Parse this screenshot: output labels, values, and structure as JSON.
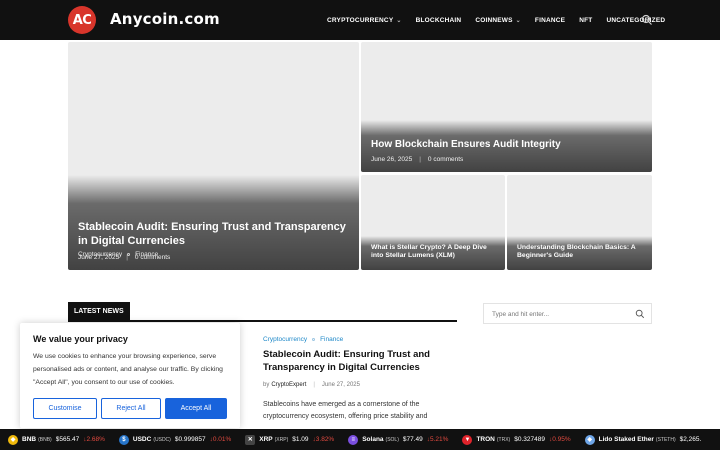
{
  "brand": {
    "badge": "AC",
    "name": "Anycoin.com",
    "badge_color": "#d8352b"
  },
  "nav": {
    "items": [
      {
        "label": "CRYPTOCURRENCY",
        "dropdown": true
      },
      {
        "label": "BLOCKCHAIN",
        "dropdown": false
      },
      {
        "label": "COINNEWS",
        "dropdown": true
      },
      {
        "label": "FINANCE",
        "dropdown": false
      },
      {
        "label": "NFT",
        "dropdown": false
      },
      {
        "label": "UNCATEGORIZED",
        "dropdown": false
      }
    ],
    "search_icon": "search-icon"
  },
  "hero": {
    "main": {
      "categories": [
        "Cryptocurrency",
        "Finance"
      ],
      "title": "Stablecoin Audit: Ensuring Trust and Transparency in Digital Currencies",
      "date": "June 27, 2025",
      "comments": "0 comments"
    },
    "top_right": {
      "title": "How Blockchain Ensures Audit Integrity",
      "date": "June 26, 2025",
      "comments": "0 comments"
    },
    "small_1": {
      "title": "What is Stellar Crypto? A Deep Dive into Stellar Lumens (XLM)"
    },
    "small_2": {
      "title": "Understanding Blockchain Basics: A Beginner's Guide"
    }
  },
  "latest_news": {
    "label": "LATEST NEWS",
    "post": {
      "categories": [
        "Cryptocurrency",
        "Finance"
      ],
      "title": "Stablecoin Audit: Ensuring Trust and Transparency in Digital Currencies",
      "by": "by",
      "author": "CryptoExpert",
      "date": "June 27, 2025",
      "excerpt": "Stablecoins have emerged as a cornerstone of the cryptocurrency ecosystem, offering price stability and"
    }
  },
  "sidebar_search": {
    "placeholder": "Type and hit enter...",
    "icon": "search-icon"
  },
  "cookie_banner": {
    "title": "We value your privacy",
    "text": "We use cookies to enhance your browsing experience, serve personalised ads or content, and analyse our traffic. By clicking \"Accept All\", you consent to our use of cookies.",
    "customise": "Customise",
    "reject": "Reject All",
    "accept": "Accept All",
    "accent_color": "#1863dc"
  },
  "ticker": [
    {
      "icon": "bnb-icon",
      "icon_color": "#f0b90b",
      "glyph": "◆",
      "name": "BNB",
      "symbol": "(BNB)",
      "price": "$565.47",
      "change": "2.68%"
    },
    {
      "icon": "usdc-icon",
      "icon_color": "#2775ca",
      "glyph": "$",
      "name": "USDC",
      "symbol": "(USDC)",
      "price": "$0.999857",
      "change": "0.01%"
    },
    {
      "icon": "xrp-icon",
      "icon_color": "#444444",
      "glyph": "✕",
      "name": "XRP",
      "symbol": "(XRP)",
      "price": "$1.09",
      "change": "3.82%"
    },
    {
      "icon": "solana-icon",
      "icon_color": "#7b4fe0",
      "glyph": "≡",
      "name": "Solana",
      "symbol": "(SOL)",
      "price": "$77.49",
      "change": "5.21%"
    },
    {
      "icon": "tron-icon",
      "icon_color": "#e0232b",
      "glyph": "▼",
      "name": "TRON",
      "symbol": "(TRX)",
      "price": "$0.327489",
      "change": "0.95%"
    },
    {
      "icon": "steth-icon",
      "icon_color": "#6fa6e8",
      "glyph": "◆",
      "name": "Lido Staked Ether",
      "symbol": "(STETH)",
      "price": "$2,265.",
      "change": ""
    }
  ]
}
